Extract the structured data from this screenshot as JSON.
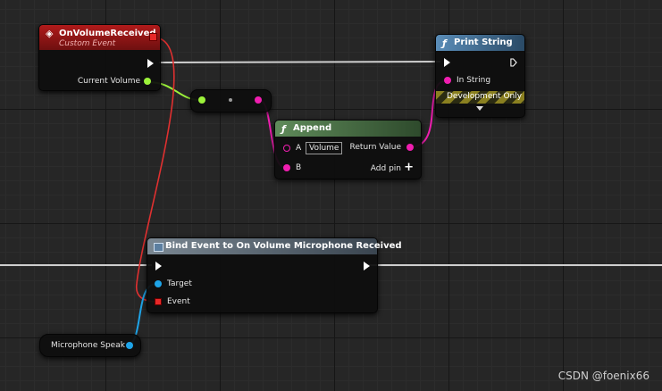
{
  "nodes": {
    "on_volume_received": {
      "title": "OnVolumeReceived",
      "subtitle": "Custom Event",
      "output_label": "Current Volume",
      "icon": "event-diamond-icon"
    },
    "reroute": {
      "icon": "reroute-dot-icon"
    },
    "append": {
      "title": "Append",
      "func_icon": "ƒ",
      "pin_a_label": "A",
      "pin_a_value": "Volume",
      "pin_b_label": "B",
      "return_label": "Return Value",
      "add_pin_label": "Add pin",
      "add_pin_icon": "+"
    },
    "print_string": {
      "title": "Print String",
      "func_icon": "ƒ",
      "in_string_label": "In String",
      "dev_only_label": "Development Only"
    },
    "bind_event": {
      "title": "Bind Event to On Volume Microphone Received",
      "target_label": "Target",
      "event_label": "Event"
    },
    "microphone_var": {
      "label": "Microphone Speak"
    }
  },
  "watermark": "CSDN @foenix66",
  "colors": {
    "event_header": "#8f1515",
    "function_header": "#3a6a8c",
    "pure_header": "#4a6e47",
    "bind_header": "#5a6672",
    "float_pin": "#9cf23a",
    "string_pin": "#f01eb0",
    "object_pin": "#1ea4e8",
    "delegate_pin": "#e82828",
    "exec_pin": "#ffffff"
  }
}
